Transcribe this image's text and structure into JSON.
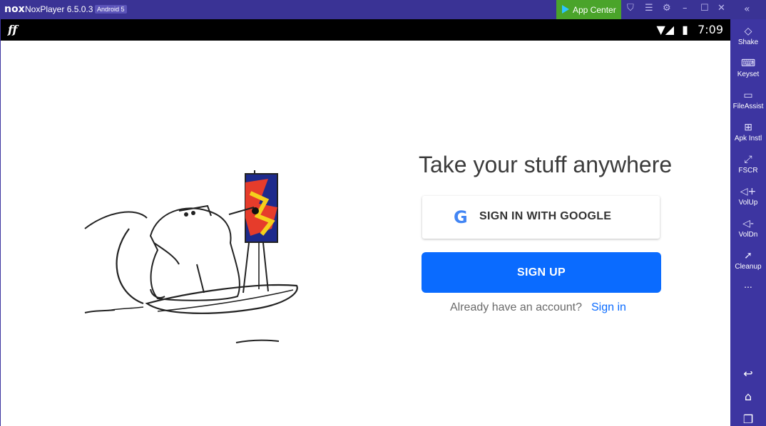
{
  "titlebar": {
    "logo": "nox",
    "app_title": "NoxPlayer 6.5.0.3",
    "android_badge": "Android 5",
    "app_center": "App Center",
    "icons": [
      "shirt-icon",
      "menu-icon",
      "gear-icon",
      "minimize-icon",
      "maximize-icon",
      "close-icon"
    ],
    "collapse_icon": "double-chevron-left-icon"
  },
  "statusbar": {
    "time": "7:09",
    "icons": [
      "wifi-icon",
      "signal-icon",
      "battery-icon"
    ]
  },
  "main": {
    "headline": "Take your stuff anywhere",
    "google_button": "SIGN IN WITH GOOGLE",
    "signup_button": "SIGN UP",
    "already_text": "Already have an account?",
    "signin_link": "Sign in"
  },
  "sidebar": {
    "items": [
      {
        "label": "Shake",
        "icon": "shake-icon"
      },
      {
        "label": "Keyset",
        "icon": "keyboard-icon"
      },
      {
        "label": "FileAssist",
        "icon": "monitor-icon"
      },
      {
        "label": "Apk Instl",
        "icon": "apk-install-icon"
      },
      {
        "label": "FSCR",
        "icon": "fullscreen-icon"
      },
      {
        "label": "VolUp",
        "icon": "volume-up-icon"
      },
      {
        "label": "VolDn",
        "icon": "volume-down-icon"
      },
      {
        "label": "Cleanup",
        "icon": "rocket-icon"
      }
    ],
    "more": "...",
    "nav": [
      "back-icon",
      "home-icon",
      "recents-icon"
    ]
  },
  "colors": {
    "frame": "#3d35a1",
    "app_center": "#4aa42a",
    "primary": "#0a6bff"
  }
}
